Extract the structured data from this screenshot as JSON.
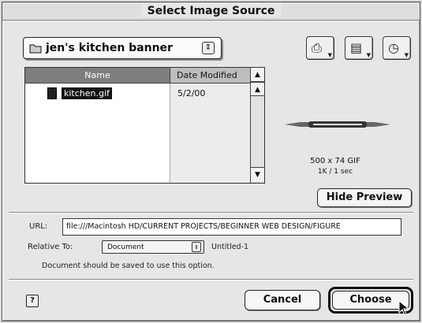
{
  "dialog": {
    "title": "Select Image Source"
  },
  "folder_popup": {
    "label": "jen's kitchen banner",
    "arrow": "⇕"
  },
  "toolbar": {
    "icons": [
      "desktop-icon",
      "document-icon",
      "clock-icon"
    ],
    "glyphs": [
      "⎙",
      "▤",
      "◷"
    ]
  },
  "file_list": {
    "columns": [
      "Name",
      "Date Modified"
    ],
    "rows": [
      {
        "name": "kitchen.gif",
        "date": "5/2/00"
      }
    ],
    "scroll_up": "▲",
    "scroll_down": "▼"
  },
  "preview": {
    "dimensions": "500 x 74 GIF",
    "size": "1K / 1 sec",
    "hide_button": "Hide Preview"
  },
  "url": {
    "label": "URL:",
    "value": "file:///Macintosh HD/CURRENT PROJECTS/BEGINNER WEB DESIGN/FIGURE"
  },
  "relative_to": {
    "label": "Relative To:",
    "value": "Document",
    "arrow": "⇕",
    "doc_name": "Untitled-1"
  },
  "note": "Document should be saved to use this option.",
  "buttons": {
    "help": "?",
    "cancel": "Cancel",
    "choose": "Choose"
  }
}
